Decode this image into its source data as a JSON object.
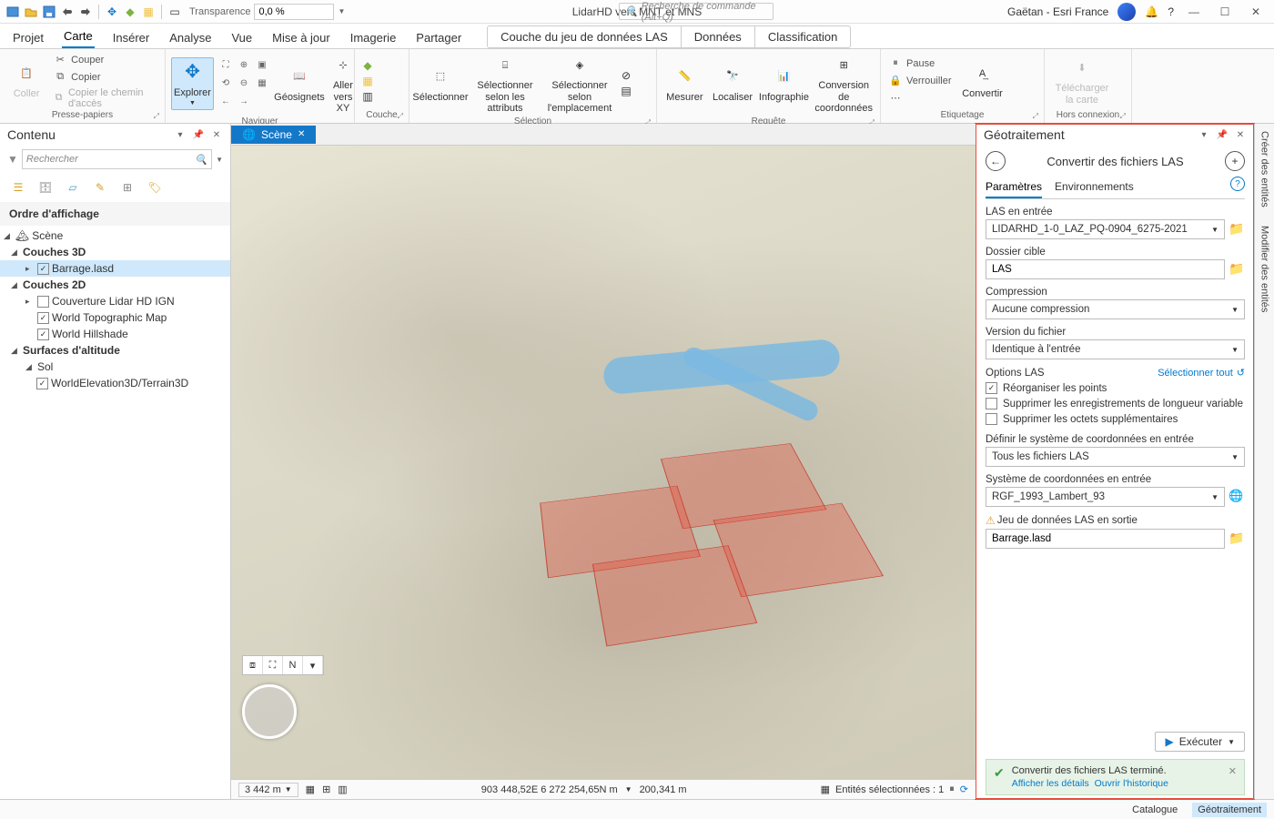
{
  "qat": {
    "transparence_label": "Transparence",
    "transparence_value": "0,0 %",
    "app_title": "LidarHD vers MNT et MNS",
    "search_placeholder": "Recherche de commande (Alt+Q)",
    "user": "Gaëtan - Esri France"
  },
  "tabs": {
    "items": [
      "Projet",
      "Carte",
      "Insérer",
      "Analyse",
      "Vue",
      "Mise à jour",
      "Imagerie",
      "Partager"
    ],
    "active": "Carte",
    "context_group": [
      "Couche du jeu de données LAS",
      "Données",
      "Classification"
    ]
  },
  "ribbon": {
    "clipboard": {
      "label": "Presse-papiers",
      "paste": "Coller",
      "cut": "Couper",
      "copy": "Copier",
      "copypath": "Copier le chemin d'accès"
    },
    "navigate": {
      "label": "Naviguer",
      "explore": "Explorer",
      "bookmarks": "Géosignets",
      "goto": "Aller vers XY"
    },
    "layer": {
      "label": "Couche"
    },
    "selection": {
      "label": "Sélection",
      "select": "Sélectionner",
      "byattr": "Sélectionner selon les attributs",
      "byloc": "Sélectionner selon l'emplacement"
    },
    "inquiry": {
      "label": "Requête",
      "measure": "Mesurer",
      "locate": "Localiser",
      "infographics": "Infographie",
      "coordconv": "Conversion de coordonnées"
    },
    "labeling": {
      "label": "Etiquetage",
      "pause": "Pause",
      "lock": "Verrouiller",
      "convert": "Convertir"
    },
    "offline": {
      "label": "Hors connexion",
      "download": "Télécharger la carte"
    }
  },
  "contents": {
    "title": "Contenu",
    "search_placeholder": "Rechercher",
    "section": "Ordre d'affichage",
    "scene": "Scène",
    "group3d": "Couches 3D",
    "barrage": "Barrage.lasd",
    "group2d": "Couches 2D",
    "cov": "Couverture Lidar HD IGN",
    "topo": "World Topographic Map",
    "hill": "World Hillshade",
    "surf": "Surfaces d'altitude",
    "sol": "Sol",
    "terrain": "WorldElevation3D/Terrain3D"
  },
  "view": {
    "tab": "Scène",
    "scale": "3 442 m",
    "coords": "903 448,52E 6 272 254,65N m",
    "elev": "200,341 m",
    "selected": "Entités sélectionnées : 1"
  },
  "gp": {
    "title": "Géotraitement",
    "tool": "Convertir des fichiers LAS",
    "tab_params": "Paramètres",
    "tab_env": "Environnements",
    "f_input": "LAS en entrée",
    "v_input": "LIDARHD_1-0_LAZ_PQ-0904_6275-2021",
    "f_target": "Dossier cible",
    "v_target": "LAS",
    "f_comp": "Compression",
    "v_comp": "Aucune compression",
    "f_ver": "Version du fichier",
    "v_ver": "Identique à l'entrée",
    "f_opts": "Options LAS",
    "selectall": "Sélectionner tout",
    "c_rearr": "Réorganiser les points",
    "c_vlr": "Supprimer les enregistrements de longueur variable",
    "c_extra": "Supprimer les octets supplémentaires",
    "f_defcs": "Définir le système de coordonnées en entrée",
    "v_defcs": "Tous les fichiers LAS",
    "f_incs": "Système de coordonnées en entrée",
    "v_incs": "RGF_1993_Lambert_93",
    "f_out": "Jeu de données LAS en sortie",
    "v_out": "Barrage.lasd",
    "run": "Exécuter",
    "msg_done": "Convertir des fichiers LAS terminé.",
    "msg_details": "Afficher les détails",
    "msg_history": "Ouvrir l'historique"
  },
  "rail": {
    "a": "Créer des entités",
    "b": "Modifier des entités"
  },
  "status": {
    "catalog": "Catalogue",
    "geoproc": "Géotraitement"
  }
}
